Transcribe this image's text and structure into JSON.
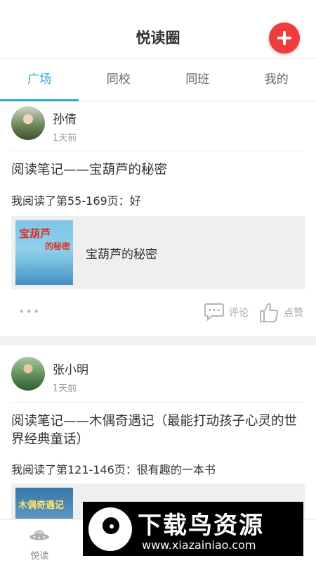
{
  "header": {
    "title": "悦读圈",
    "add_icon": "plus-icon",
    "accent": "#ef3b3b"
  },
  "tabs": [
    {
      "label": "广场",
      "active": true
    },
    {
      "label": "同校",
      "active": false
    },
    {
      "label": "同班",
      "active": false
    },
    {
      "label": "我的",
      "active": false
    }
  ],
  "accent_color": "#2aa5d8",
  "posts": [
    {
      "author": "孙倩",
      "time": "1天前",
      "title": "阅读笔记——宝葫芦的秘密",
      "progress": "我阅读了第55-169页：好",
      "book": {
        "title": "宝葫芦的秘密",
        "cover_title": "宝葫芦",
        "cover_sub": "的秘密"
      },
      "more": "•••",
      "comment_label": "评论",
      "like_label": "点赞"
    },
    {
      "author": "张小明",
      "time": "1天前",
      "title": "阅读笔记——木偶奇遇记（最能打动孩子心灵的世界经典童话）",
      "progress": "我阅读了第121-146页：很有趣的一本书",
      "book": {
        "cover_title": "木偶奇遇记"
      }
    }
  ],
  "bottom_nav": [
    {
      "label": "悦读",
      "icon": "ufo-icon",
      "active": false
    }
  ],
  "watermark": {
    "text": "下载鸟资源",
    "url": "www.xiazainiao.com"
  }
}
